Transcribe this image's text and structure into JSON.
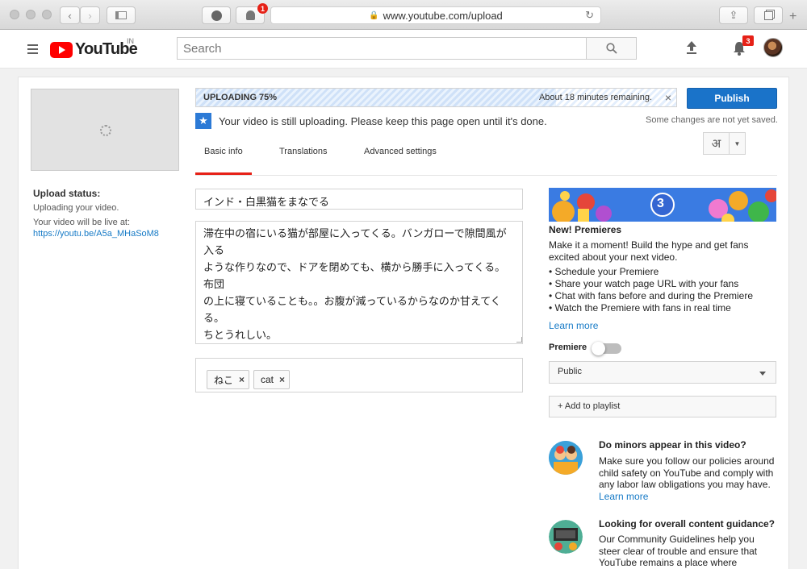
{
  "browser": {
    "url": "www.youtube.com/upload",
    "extension_badge": "1"
  },
  "masthead": {
    "logo_text": "YouTube",
    "country_code": "IN",
    "search_placeholder": "Search",
    "notifications_count": "3"
  },
  "left": {
    "status_title": "Upload status:",
    "status_text": "Uploading your video.",
    "live_at_label": "Your video will be live at:",
    "live_url": "https://youtu.be/A5a_MHaSoM8"
  },
  "upload": {
    "progress_label": "UPLOADING 75%",
    "progress_fraction": 0.75,
    "time_remaining": "About 18 minutes remaining.",
    "publish_label": "Publish",
    "info_message": "Your video is still uploading. Please keep this page open until it's done.",
    "unsaved_note": "Some changes are not yet saved."
  },
  "tabs": [
    {
      "label": "Basic info",
      "active": true
    },
    {
      "label": "Translations",
      "active": false
    },
    {
      "label": "Advanced settings",
      "active": false
    }
  ],
  "language_button": "अ",
  "form": {
    "title": "インド・白黒猫をまなでる",
    "description": "滞在中の宿にいる猫が部屋に入ってくる。バンガローで隙間風が入る\nような作りなので、ドアを閉めても、横から勝手に入ってくる。布団\nの上に寝ていることも。。お腹が減っているからなのか甘えてくる。\nちとうれしい。",
    "tags": [
      "ねこ",
      "cat"
    ]
  },
  "premieres": {
    "banner_number": "3",
    "title": "New! Premieres",
    "description": "Make it a moment! Build the hype and get fans excited about your next video.",
    "bullets": [
      "Schedule your Premiere",
      "Share your watch page URL with your fans",
      "Chat with fans before and during the Premiere",
      "Watch the Premiere with fans in real time"
    ],
    "learn_more": "Learn more",
    "toggle_label": "Premiere",
    "toggle_on": false
  },
  "visibility": {
    "selected": "Public"
  },
  "playlist_button": "+ Add to playlist",
  "guidance": [
    {
      "title": "Do minors appear in this video?",
      "text": "Make sure you follow our policies around child safety on YouTube and comply with any labor law obligations you may have.",
      "link": "Learn more"
    },
    {
      "title": "Looking for overall content guidance?",
      "text": "Our Community Guidelines help you steer clear of trouble and ensure that YouTube remains a place where"
    }
  ],
  "colors": {
    "accent": "#1a73c9",
    "youtube_red": "#ff0000",
    "link": "#167ac6",
    "tab_underline": "#e62117"
  }
}
